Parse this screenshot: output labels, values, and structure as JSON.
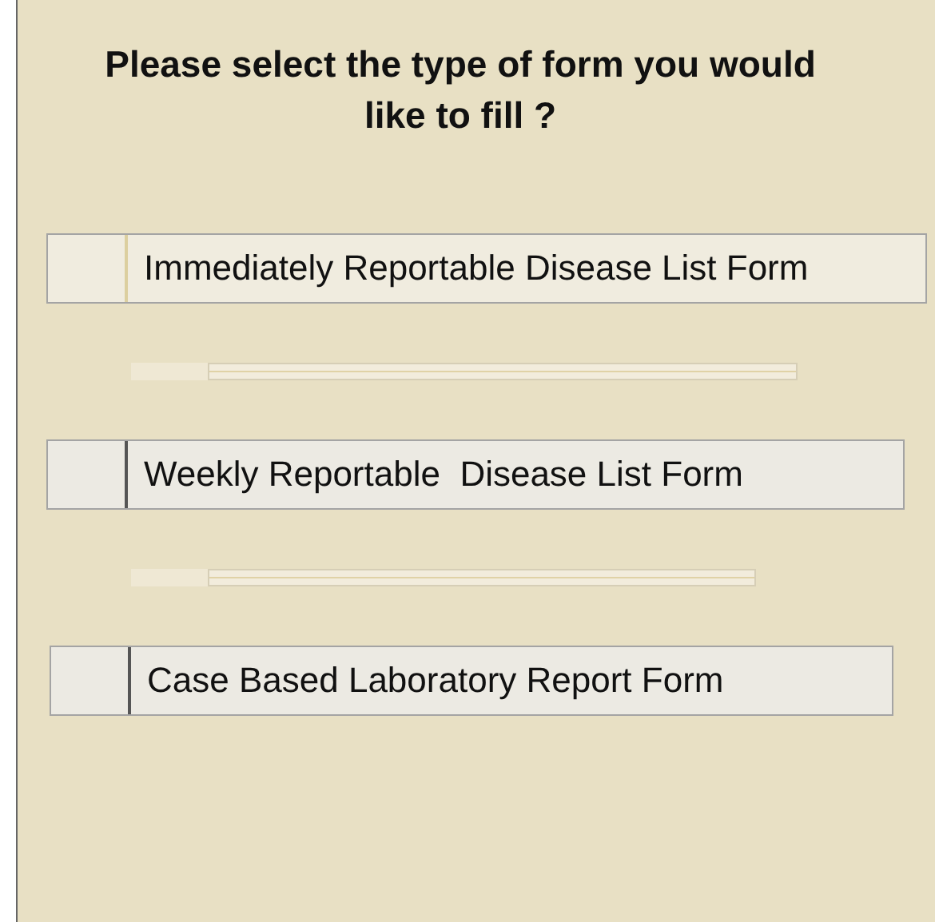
{
  "title": "Please select the type of form you would like to fill ?",
  "options": [
    {
      "label": "Immediately Reportable Disease List Form",
      "selected": true
    },
    {
      "label": "Weekly Reportable  Disease List Form",
      "selected": false
    },
    {
      "label": "Case Based Laboratory Report Form",
      "selected": false
    }
  ]
}
